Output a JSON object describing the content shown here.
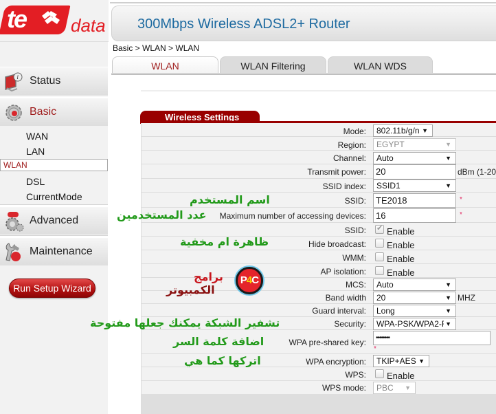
{
  "brand": {
    "logo_main": "te",
    "logo_sub": "data",
    "accent": "#e31e24"
  },
  "header": {
    "title": "300Mbps Wireless ADSL2+ Router"
  },
  "breadcrumb": "Basic > WLAN > WLAN",
  "tabs": [
    {
      "label": "WLAN",
      "active": true
    },
    {
      "label": "WLAN Filtering",
      "active": false
    },
    {
      "label": "WLAN WDS",
      "active": false
    }
  ],
  "sidebar": {
    "menus": [
      {
        "label": "Status",
        "icon": "status-monitor-icon"
      },
      {
        "label": "Basic",
        "icon": "gear-icon",
        "active": true,
        "items": [
          {
            "label": "WAN"
          },
          {
            "label": "LAN"
          },
          {
            "label": "WLAN",
            "selected": true
          },
          {
            "label": "DSL"
          },
          {
            "label": "CurrentMode"
          }
        ]
      },
      {
        "label": "Advanced",
        "icon": "advanced-gears-icon"
      },
      {
        "label": "Maintenance",
        "icon": "wrench-icon"
      }
    ],
    "wizard_label": "Run Setup Wizard"
  },
  "section": {
    "title": "Wireless Settings"
  },
  "form": {
    "mode": {
      "label": "Mode:",
      "value": "802.11b/g/n"
    },
    "region": {
      "label": "Region:",
      "value": "EGYPT",
      "disabled": true
    },
    "channel": {
      "label": "Channel:",
      "value": "Auto"
    },
    "transmit_power": {
      "label": "Transmit power:",
      "value": "20",
      "unit": "dBm (1-20"
    },
    "ssid_index": {
      "label": "SSID index:",
      "value": "SSID1"
    },
    "ssid": {
      "label": "SSID:",
      "value": "TE2018",
      "required": "*"
    },
    "max_devices": {
      "label": "Maximum number of accessing devices:",
      "value": "16",
      "required": "*"
    },
    "ssid_enable": {
      "label": "SSID:",
      "checkbox_label": "Enable",
      "checked": true,
      "disabled": true
    },
    "hide_broadcast": {
      "label": "Hide broadcast:",
      "checkbox_label": "Enable",
      "checked": false
    },
    "wmm": {
      "label": "WMM:",
      "checkbox_label": "Enable",
      "checked": false
    },
    "ap_isolation": {
      "label": "AP isolation:",
      "checkbox_label": "Enable",
      "checked": false
    },
    "mcs": {
      "label": "MCS:",
      "value": "Auto"
    },
    "band_width": {
      "label": "Band width",
      "value": "20",
      "unit": "MHZ"
    },
    "guard_interval": {
      "label": "Guard interval:",
      "value": "Long"
    },
    "security": {
      "label": "Security:",
      "value": "WPA-PSK/WPA2-F"
    },
    "wpa_key": {
      "label": "WPA pre-shared key:",
      "value": "••••••••",
      "required": "*"
    },
    "wpa_encryption": {
      "label": "WPA encryption:",
      "value": "TKIP+AES"
    },
    "wps": {
      "label": "WPS:",
      "checkbox_label": "Enable",
      "checked": false
    },
    "wps_mode": {
      "label": "WPS mode:",
      "value": "PBC",
      "disabled": true
    }
  },
  "annotations": {
    "ssid_note": "اسم المستخدم",
    "devices_note": "عدد المستخدمين",
    "hide_note": "ظاهرة ام مخفية",
    "security_note": "تشفير الشبكة يمكنك جعلها مفتوحة",
    "key_note": "اضافة كلمة السر",
    "encryption_note": "اتركها كما هي",
    "watermark_line1": "برامج",
    "watermark_line2": "الكمبيوتر",
    "watermark_badge_a": "P",
    "watermark_badge_b": "4",
    "watermark_badge_c": "C"
  }
}
